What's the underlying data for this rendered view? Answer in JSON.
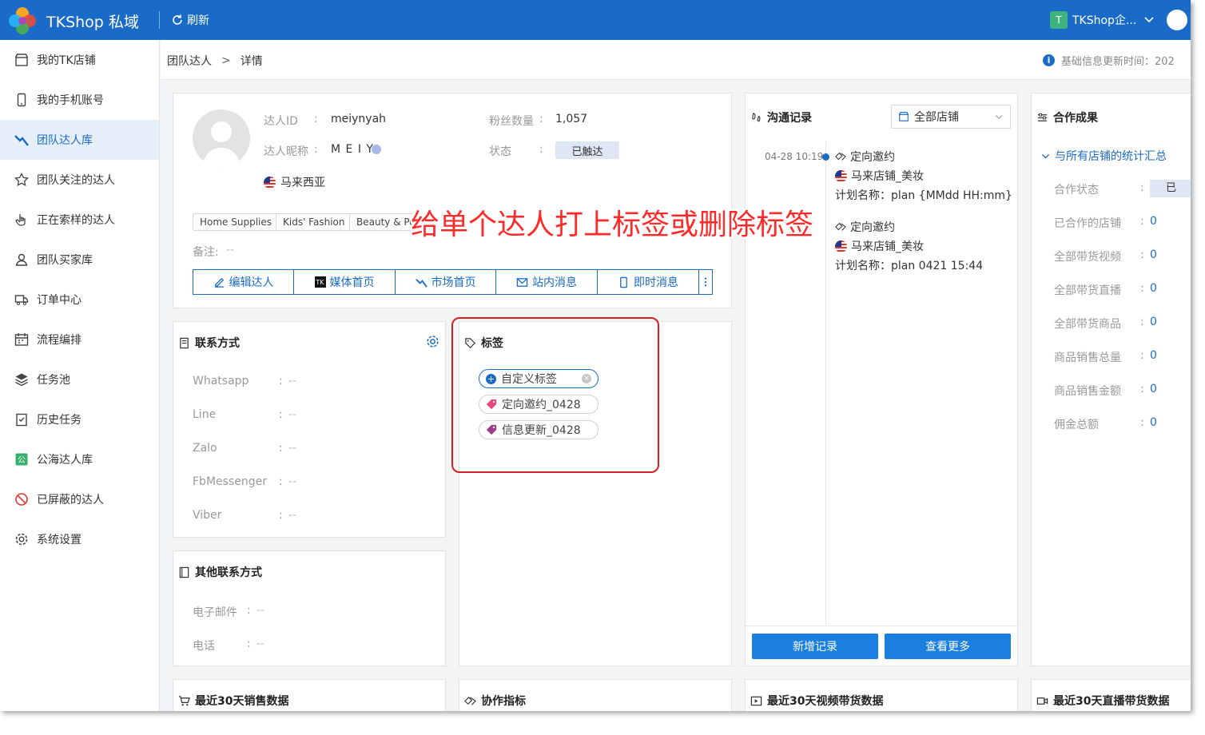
{
  "header": {
    "app_title": "TKShop 私域",
    "refresh_label": "刷新",
    "user_initial": "T",
    "user_name": "TKShop企..."
  },
  "sidebar": {
    "items": [
      {
        "label": "我的TK店铺",
        "icon": "shop-icon"
      },
      {
        "label": "我的手机账号",
        "icon": "phone-icon"
      },
      {
        "label": "团队达人库",
        "icon": "influencer-library-icon",
        "active": true
      },
      {
        "label": "团队关注的达人",
        "icon": "star-icon"
      },
      {
        "label": "正在索样的达人",
        "icon": "hand-pointer-icon"
      },
      {
        "label": "团队买家库",
        "icon": "user-icon"
      },
      {
        "label": "订单中心",
        "icon": "truck-icon"
      },
      {
        "label": "流程编排",
        "icon": "calendar-icon"
      },
      {
        "label": "任务池",
        "icon": "layers-icon"
      },
      {
        "label": "历史任务",
        "icon": "clipboard-check-icon"
      },
      {
        "label": "公海达人库",
        "icon": "public-pool-icon"
      },
      {
        "label": "已屏蔽的达人",
        "icon": "block-icon"
      },
      {
        "label": "系统设置",
        "icon": "gear-icon"
      }
    ]
  },
  "breadcrumb": {
    "parent": "团队达人",
    "separator": ">",
    "current": "详情"
  },
  "info_right": "基础信息更新时间：202",
  "profile": {
    "id_label": "达人ID",
    "id_value": "meiynyah",
    "nick_label": "达人昵称",
    "nick_value": "M E I Y",
    "fans_label": "粉丝数量",
    "fans_value": "1,057",
    "status_label": "状态",
    "status_value": "已触达",
    "country": "马来西亚",
    "colon": ":",
    "tags": [
      "Home Supplies",
      "Kids' Fashion",
      "Beauty & Per"
    ],
    "remark_label": "备注:",
    "remark_value": "--",
    "buttons": [
      "编辑达人",
      "媒体首页",
      "市场首页",
      "站内消息",
      "即时消息"
    ]
  },
  "contact": {
    "title": "联系方式",
    "rows": [
      {
        "label": "Whatsapp",
        "value": "--"
      },
      {
        "label": "Line",
        "value": "--"
      },
      {
        "label": "Zalo",
        "value": "--"
      },
      {
        "label": "FbMessenger",
        "value": "--"
      },
      {
        "label": "Viber",
        "value": "--"
      }
    ]
  },
  "other_contact": {
    "title": "其他联系方式",
    "rows": [
      {
        "label": "电子邮件",
        "value": "--"
      },
      {
        "label": "电话",
        "value": "--"
      }
    ]
  },
  "labels": {
    "title": "标签",
    "items": [
      {
        "text": "自定义标签",
        "color": "#1a6bc8"
      },
      {
        "text": "定向邀约_0428",
        "color": "#e8457a"
      },
      {
        "text": "信息更新_0428",
        "color": "#9c3d8c"
      }
    ]
  },
  "overlay_caption": "给单个达人打上标签或删除标签",
  "communication": {
    "title": "沟通记录",
    "store_select": "全部店铺",
    "records": [
      {
        "time": "04-28 10:19",
        "type": "定向邀约",
        "store": "马来店铺_美妆",
        "plan": "计划名称：plan {MMdd HH:mm}"
      },
      {
        "time": "",
        "type": "定向邀约",
        "store": "马来店铺_美妆",
        "plan": "计划名称：plan 0421 15:44"
      }
    ],
    "add_button": "新增记录",
    "more_button": "查看更多"
  },
  "cooperation": {
    "title": "合作成果",
    "summary_link": "与所有店铺的统计汇总",
    "status_label": "合作状态",
    "status_value": "已",
    "rows": [
      {
        "label": "已合作的店铺",
        "value": "0"
      },
      {
        "label": "全部带货视频",
        "value": "0"
      },
      {
        "label": "全部带货直播",
        "value": "0"
      },
      {
        "label": "全部带货商品",
        "value": "0"
      },
      {
        "label": "商品销售总量",
        "value": "0"
      },
      {
        "label": "商品销售金额",
        "value": "0"
      },
      {
        "label": "佣金总额",
        "value": "0"
      }
    ]
  },
  "bottom_panels": [
    "最近30天销售数据",
    "协作指标",
    "最近30天视频带货数据",
    "最近30天直播带货数据"
  ]
}
